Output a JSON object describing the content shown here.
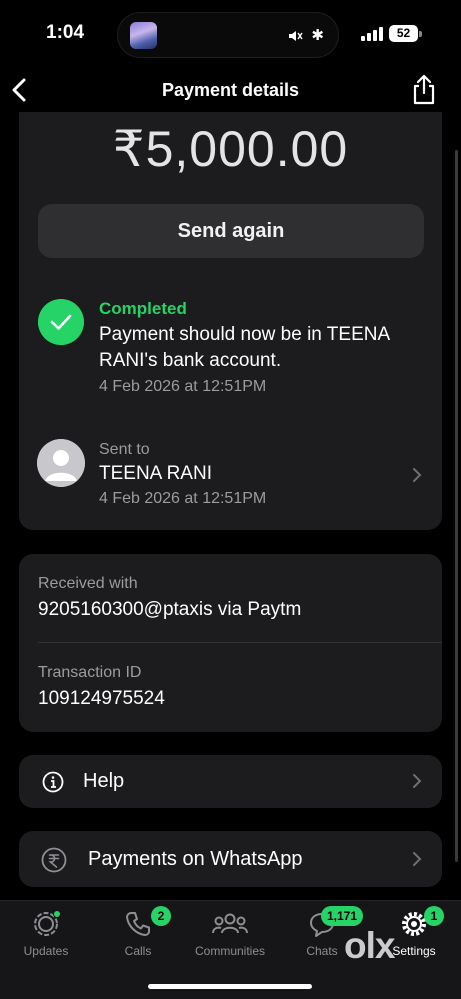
{
  "status_bar": {
    "time": "1:04",
    "battery": "52"
  },
  "nav": {
    "title": "Payment details"
  },
  "payment": {
    "amount": "₹5,000.00",
    "send_again_label": "Send again",
    "status_label": "Completed",
    "status_message": "Payment should now be in TEENA RANI's bank account.",
    "status_date": "4 Feb 2026 at 12:51PM",
    "sent_to_label": "Sent to",
    "recipient_name": "TEENA RANI",
    "sent_date": "4 Feb 2026 at 12:51PM"
  },
  "details": {
    "received_with_label": "Received with",
    "received_with_value": "9205160300@ptaxis via Paytm",
    "transaction_id_label": "Transaction ID",
    "transaction_id_value": "109124975524"
  },
  "links": {
    "help_label": "Help",
    "payments_label": "Payments on WhatsApp"
  },
  "tab_bar": {
    "tabs": [
      {
        "label": "Updates",
        "icon": "updates-icon"
      },
      {
        "label": "Calls",
        "icon": "phone-icon",
        "badge": "2"
      },
      {
        "label": "Communities",
        "icon": "communities-icon"
      },
      {
        "label": "Chats",
        "icon": "chat-bubbles-icon",
        "badge": "1,171"
      },
      {
        "label": "Settings",
        "icon": "gear-icon",
        "badge": "1"
      }
    ]
  },
  "watermark": "olx",
  "colors": {
    "accent": "#25d366",
    "card": "#1c1c1e",
    "background": "#000000"
  }
}
